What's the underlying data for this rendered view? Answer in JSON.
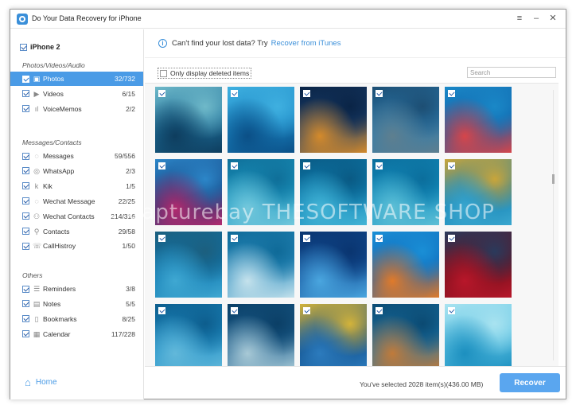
{
  "app": {
    "title": "Do Your Data Recovery for iPhone"
  },
  "window_controls": {
    "menu": "≡",
    "minimize": "–",
    "close": "✕"
  },
  "colors": {
    "accent": "#4a9be6",
    "link": "#3a8fd9",
    "recover_button": "#5aa6ef"
  },
  "device": {
    "name": "iPhone 2",
    "checked": true
  },
  "sidebar": {
    "sections": [
      {
        "title": "Photos/Videos/Audio",
        "items": [
          {
            "label": "Photos",
            "count": "32/732",
            "icon": "image-icon",
            "active": true
          },
          {
            "label": "Videos",
            "count": "6/15",
            "icon": "video-icon"
          },
          {
            "label": "VoiceMemos",
            "count": "2/2",
            "icon": "waveform-icon"
          }
        ]
      },
      {
        "title": "Messages/Contacts",
        "items": [
          {
            "label": "Messages",
            "count": "59/556",
            "icon": "chat-bubble-icon"
          },
          {
            "label": "WhatsApp",
            "count": "2/3",
            "icon": "whatsapp-icon"
          },
          {
            "label": "Kik",
            "count": "1/5",
            "icon": "kik-icon"
          },
          {
            "label": "Wechat Message",
            "count": "22/25",
            "icon": "wechat-bubble-icon"
          },
          {
            "label": "Wechat Contacts",
            "count": "214/316",
            "icon": "contacts-group-icon"
          },
          {
            "label": "Contacts",
            "count": "29/58",
            "icon": "person-icon"
          },
          {
            "label": "CallHistroy",
            "count": "1/50",
            "icon": "phone-icon"
          }
        ]
      },
      {
        "title": "Others",
        "items": [
          {
            "label": "Reminders",
            "count": "3/8",
            "icon": "list-icon"
          },
          {
            "label": "Notes",
            "count": "5/5",
            "icon": "note-icon"
          },
          {
            "label": "Bookmarks",
            "count": "8/25",
            "icon": "bookmark-icon"
          },
          {
            "label": "Calendar",
            "count": "117/228",
            "icon": "calendar-icon"
          }
        ]
      }
    ],
    "home_label": "Home"
  },
  "info": {
    "text": "Can't find your lost data? Try",
    "link": "Recover from iTunes"
  },
  "filter": {
    "label": "Only display deleted items",
    "checked": false
  },
  "search": {
    "placeholder": "Search",
    "value": ""
  },
  "photos": {
    "rows": 4,
    "columns": 5,
    "all_checked": true
  },
  "footer": {
    "status": "You've selected 2028 item(s)(436.00 MB)",
    "recover_label": "Recover"
  },
  "watermark": "© Capturebay THESOFTWARE SHOP"
}
